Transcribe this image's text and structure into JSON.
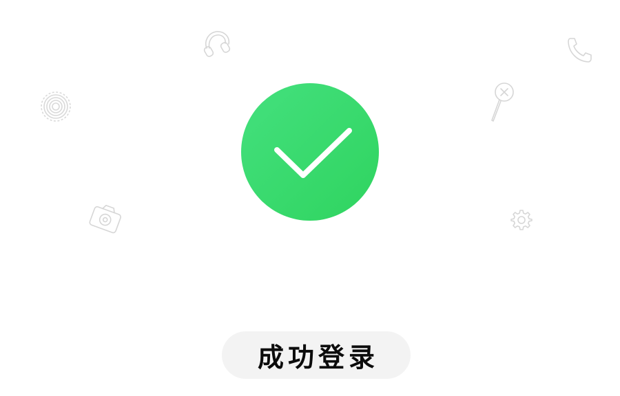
{
  "status": {
    "message": "成功登录",
    "icon": "check-icon",
    "accent_color": "#34d868"
  },
  "decorations": [
    "headphones-icon",
    "phone-icon",
    "gear-wheel-icon",
    "magnifier-icon",
    "camera-icon",
    "settings-gear-icon"
  ]
}
